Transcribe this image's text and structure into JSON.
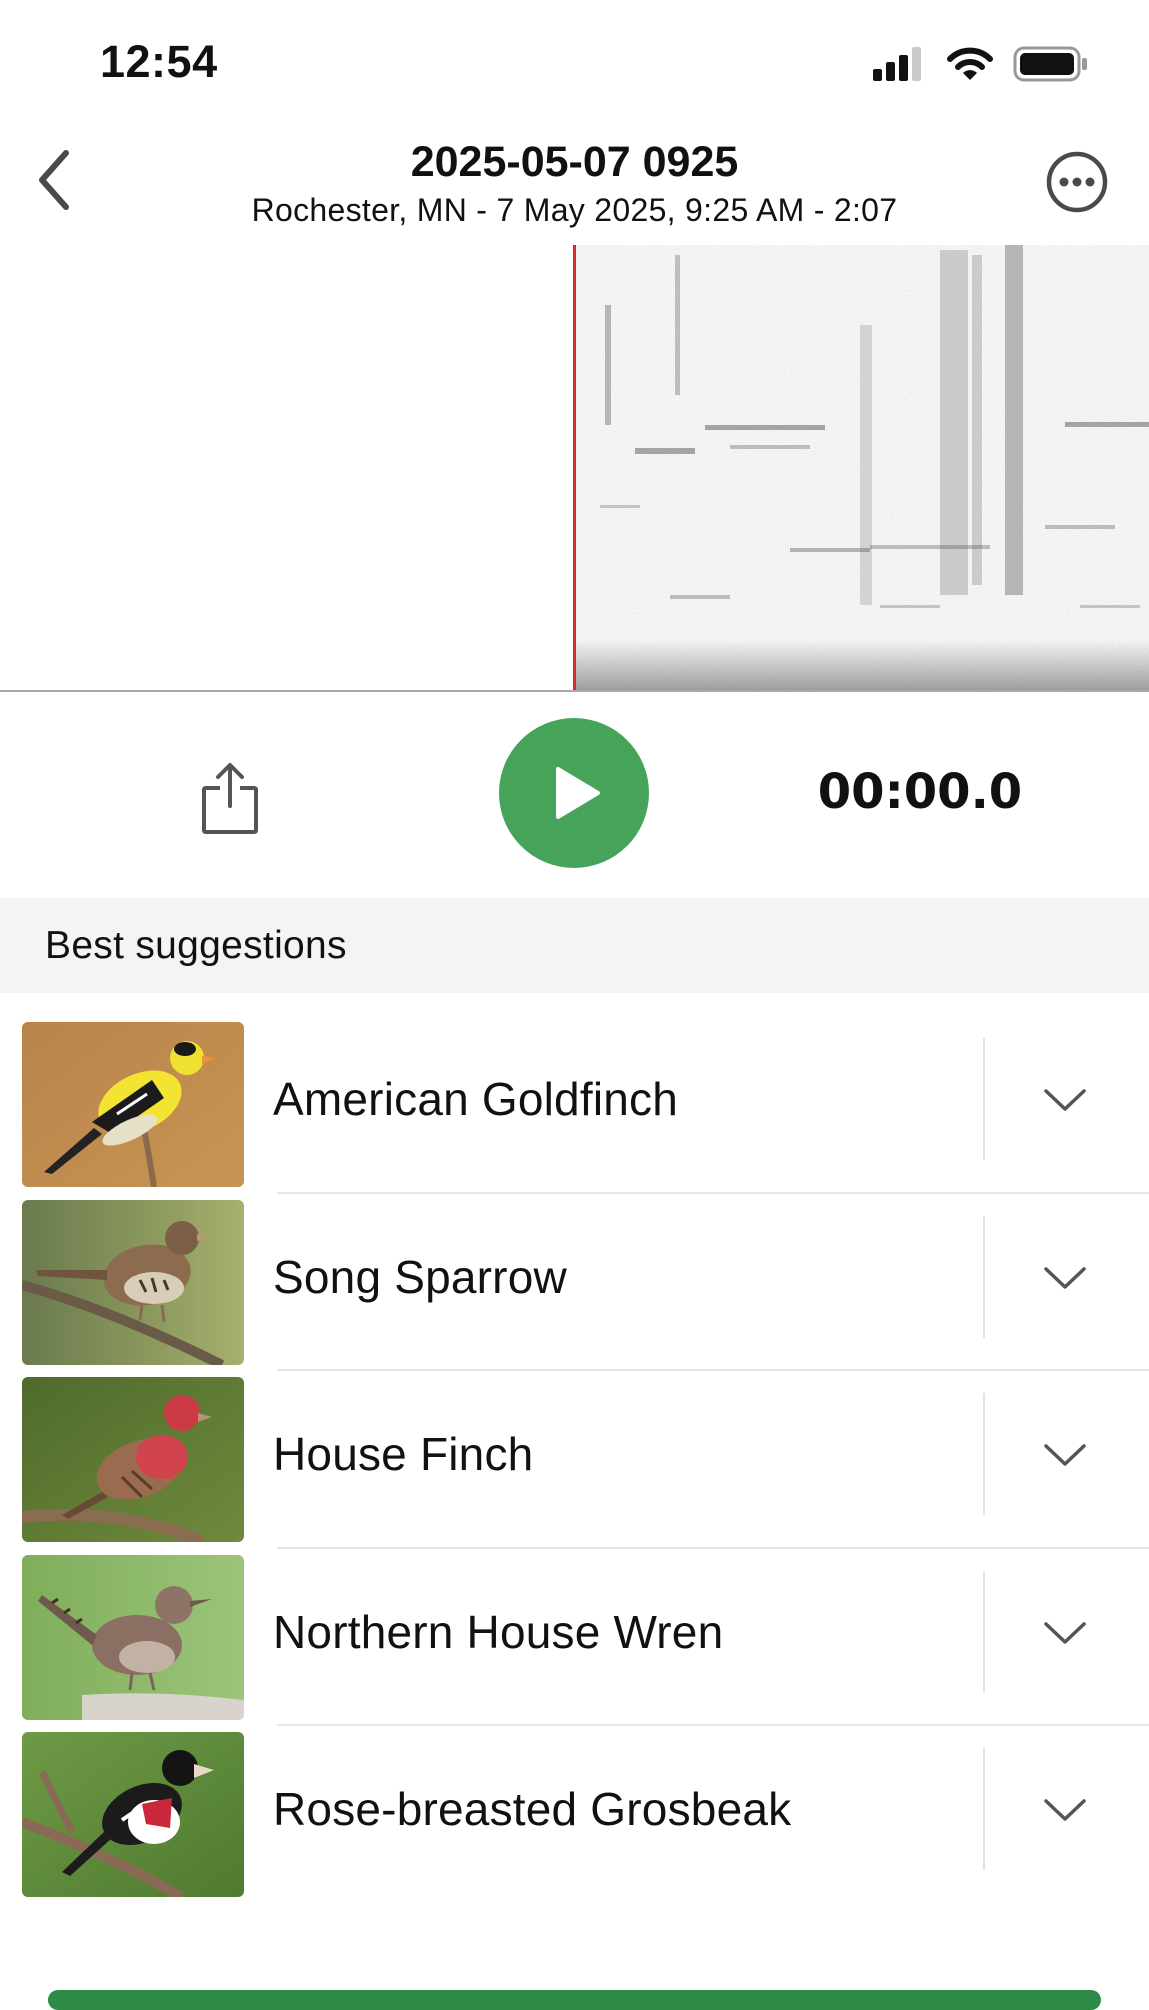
{
  "status_bar": {
    "time": "12:54"
  },
  "nav": {
    "title": "2025-05-07 0925",
    "subtitle": "Rochester, MN - 7 May 2025, 9:25 AM - 2:07"
  },
  "player": {
    "timer": "00:00.0",
    "accent_color": "#45a35a",
    "playhead_color": "#d42a2a"
  },
  "suggestions": {
    "header": "Best suggestions",
    "items": [
      {
        "name": "American Goldfinch",
        "photo": "american-goldfinch-photo"
      },
      {
        "name": "Song Sparrow",
        "photo": "song-sparrow-photo"
      },
      {
        "name": "House Finch",
        "photo": "house-finch-photo"
      },
      {
        "name": "Northern House Wren",
        "photo": "northern-house-wren-photo"
      },
      {
        "name": "Rose-breasted Grosbeak",
        "photo": "rose-breasted-grosbeak-photo"
      }
    ]
  }
}
